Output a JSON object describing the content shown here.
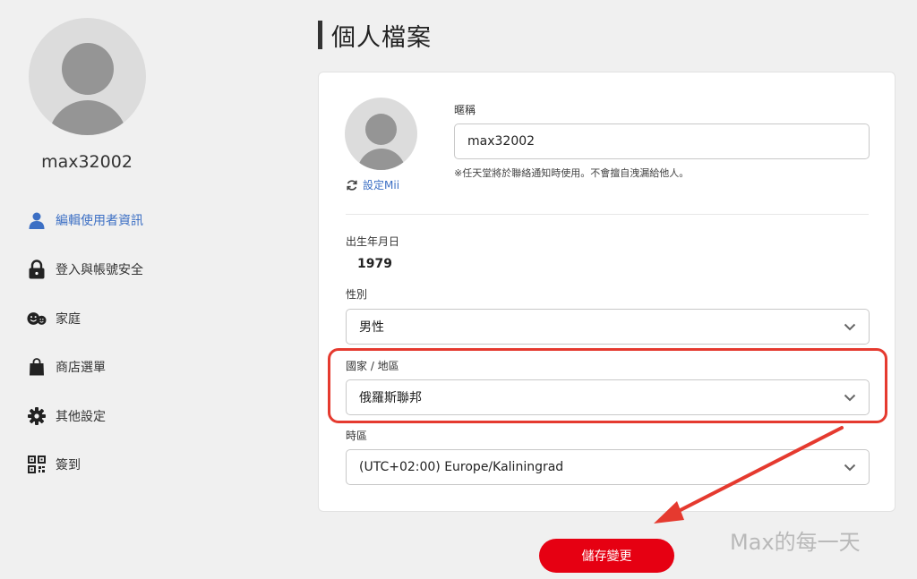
{
  "sidebar": {
    "username": "max32002",
    "items": [
      {
        "label": "編輯使用者資訊",
        "icon": "user-icon",
        "active": true
      },
      {
        "label": "登入與帳號安全",
        "icon": "lock-icon"
      },
      {
        "label": "家庭",
        "icon": "family-icon"
      },
      {
        "label": "商店選單",
        "icon": "shopping-bag-icon"
      },
      {
        "label": "其他設定",
        "icon": "gear-icon"
      },
      {
        "label": "簽到",
        "icon": "qr-code-icon"
      }
    ]
  },
  "page": {
    "title": "個人檔案"
  },
  "profile": {
    "mii_label": "設定Mii",
    "nickname_label": "暱稱",
    "nickname_value": "max32002",
    "nickname_note": "※任天堂將於聯絡通知時使用。不會擅自洩漏給他人。",
    "birth_label": "出生年月日",
    "birth_value": "1979",
    "gender_label": "性別",
    "gender_value": "男性",
    "country_label": "國家 / 地區",
    "country_value": "俄羅斯聯邦",
    "timezone_label": "時區",
    "timezone_value": "(UTC+02:00) Europe/Kaliningrad"
  },
  "actions": {
    "save_label": "儲存變更"
  },
  "watermark": "Max的每一天",
  "colors": {
    "accent_blue": "#3c6fc4",
    "save_red": "#e60012",
    "highlight_red": "#e53a2f"
  }
}
